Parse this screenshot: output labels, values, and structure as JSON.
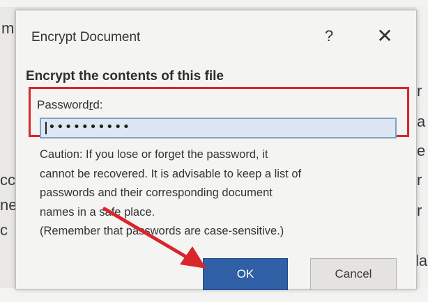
{
  "dialog": {
    "title": "Encrypt Document",
    "help_glyph": "?",
    "close_glyph": "✕",
    "heading": "Encrypt the contents of this file",
    "password_label_before": "Password",
    "password_label_accel": "r",
    "password_label_after": "d:",
    "password_masked_value": "••••••••••",
    "caution_lines": [
      "Caution: If you lose or forget the password, it",
      "cannot be recovered. It is advisable to keep a list of",
      "passwords and their corresponding document",
      "names in a safe place.",
      "(Remember that passwords are case-sensitive.)"
    ],
    "ok_label": "OK",
    "cancel_label": "Cancel"
  },
  "background_fragments": {
    "left_1": "m",
    "left_2": "cc",
    "left_3": "ne",
    "left_4": "c",
    "right_1": "r",
    "right_2": "a",
    "right_3": "e",
    "right_4": "r",
    "right_5": "r",
    "right_6": "la"
  },
  "colors": {
    "highlight_border": "#d8262b",
    "ok_button": "#2f5fa4",
    "annotation_arrow": "#d8262b"
  }
}
